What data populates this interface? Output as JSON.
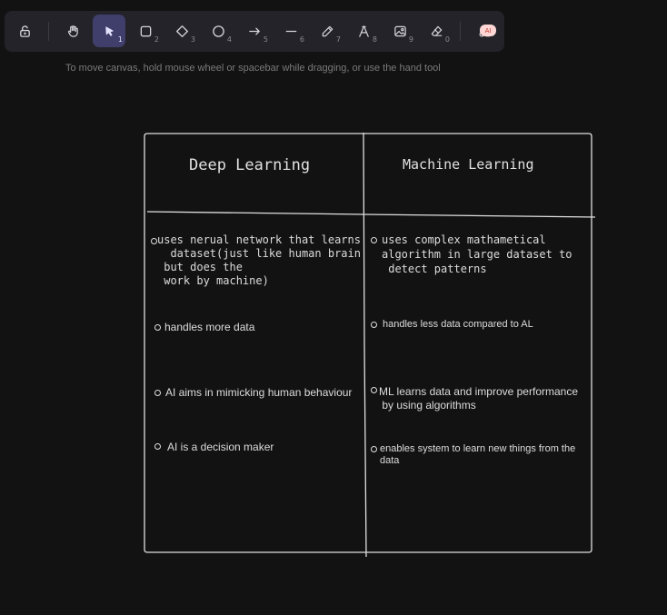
{
  "toolbar": {
    "tools": [
      {
        "name": "lock",
        "shortcut": ""
      },
      {
        "name": "hand",
        "shortcut": ""
      },
      {
        "name": "selection",
        "shortcut": "1"
      },
      {
        "name": "rectangle",
        "shortcut": "2"
      },
      {
        "name": "diamond",
        "shortcut": "3"
      },
      {
        "name": "ellipse",
        "shortcut": "4"
      },
      {
        "name": "arrow",
        "shortcut": "5"
      },
      {
        "name": "line",
        "shortcut": "6"
      },
      {
        "name": "draw",
        "shortcut": "7"
      },
      {
        "name": "text",
        "shortcut": "8"
      },
      {
        "name": "image",
        "shortcut": "9"
      },
      {
        "name": "eraser",
        "shortcut": "0"
      },
      {
        "name": "more-tools",
        "shortcut": ""
      }
    ],
    "active_tool": "selection",
    "ai_badge": "AI"
  },
  "hint": "To move canvas, hold mouse wheel or spacebar while dragging, or use the hand tool",
  "table": {
    "left": {
      "heading": "Deep Learning",
      "items": [
        "uses nerual network that learns\n  dataset(just like human brain\n but does the\n work by machine)",
        "handles more data",
        "AI aims in mimicking human behaviour",
        "AI is a decision maker"
      ]
    },
    "right": {
      "heading": "Machine Learning",
      "items": [
        "uses complex mathametical\nalgorithm in large dataset to\n detect patterns",
        "handles less data compared to AL",
        "ML learns data and improve performance\n by using algorithms",
        "enables system to learn new things from the\ndata"
      ]
    }
  },
  "colors": {
    "background": "#121212",
    "toolbar": "#232329",
    "active_tool": "#403e6a",
    "stroke": "#e0e0e0"
  }
}
